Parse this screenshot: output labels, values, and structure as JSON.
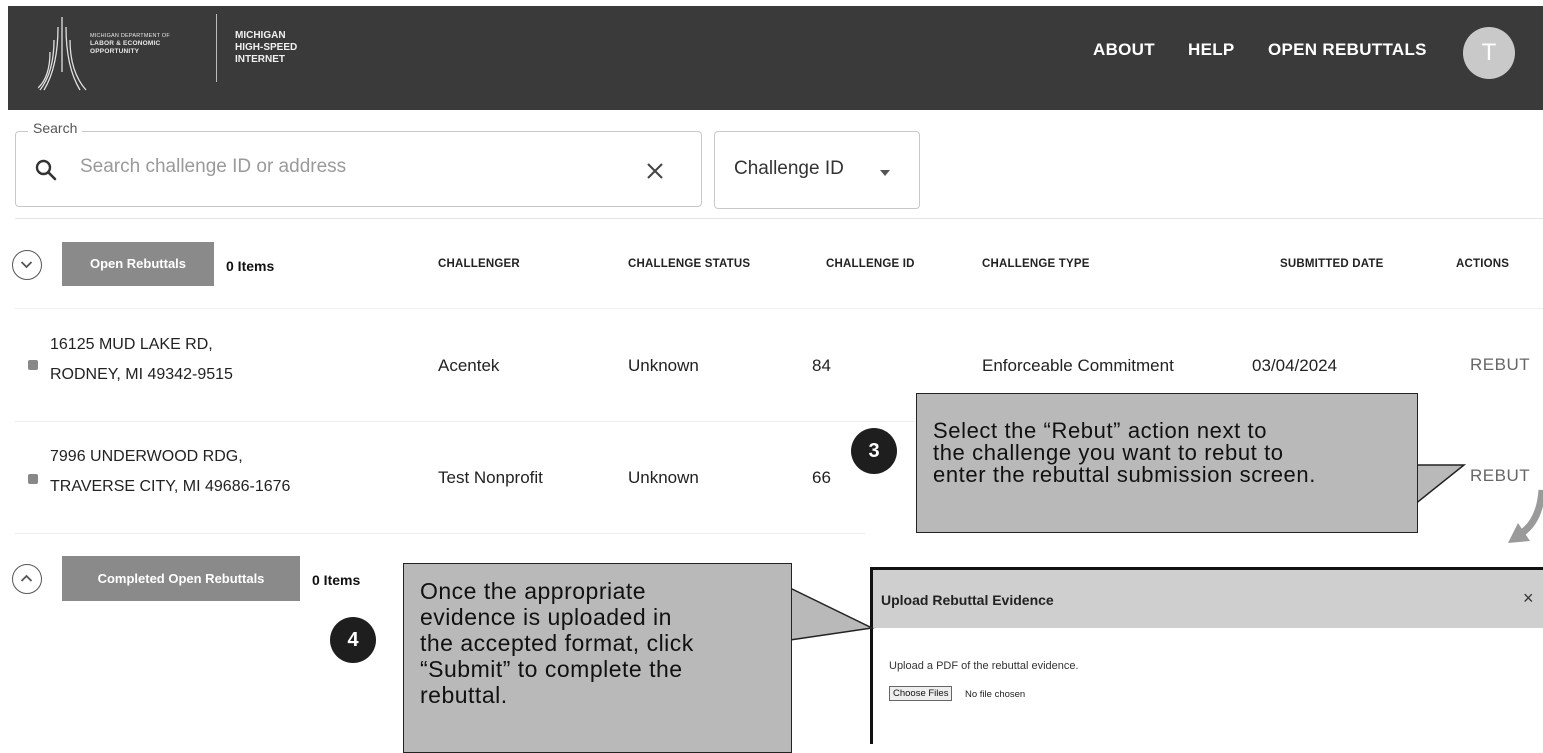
{
  "header": {
    "logo_lines": [
      "MICHIGAN DEPARTMENT OF",
      "LABOR & ECONOMIC",
      "OPPORTUNITY"
    ],
    "program_lines": [
      "MICHIGAN",
      "HIGH-SPEED",
      "INTERNET"
    ],
    "nav": [
      "ABOUT",
      "HELP",
      "OPEN REBUTTALS"
    ],
    "avatar_initial": "T"
  },
  "search": {
    "legend": "Search",
    "placeholder": "Search challenge ID or address",
    "filter_selected": "Challenge ID"
  },
  "columns": [
    "CHALLENGER",
    "CHALLENGE STATUS",
    "CHALLENGE ID",
    "CHALLENGE TYPE",
    "SUBMITTED DATE",
    "ACTIONS"
  ],
  "groups": {
    "open": {
      "label": "Open Rebuttals",
      "count": "0 Items"
    },
    "completed": {
      "label": "Completed Open Rebuttals",
      "count": "0 Items"
    }
  },
  "rows": [
    {
      "address_line1": "16125 MUD LAKE RD,",
      "address_line2": "RODNEY, MI 49342-9515",
      "challenger": "Acentek",
      "status": "Unknown",
      "challenge_id": "84",
      "type": "Enforceable Commitment",
      "date": "03/04/2024",
      "action": "REBUT"
    },
    {
      "address_line1": "7996 UNDERWOOD RDG,",
      "address_line2": "TRAVERSE CITY, MI 49686-1676",
      "challenger": "Test Nonprofit",
      "status": "Unknown",
      "challenge_id": "66",
      "action": "REBUT"
    }
  ],
  "callouts": {
    "step3": {
      "number": "3",
      "lines": [
        "Select the “Rebut” action next to",
        "the challenge you want to rebut to",
        "enter the rebuttal submission screen."
      ]
    },
    "step4": {
      "number": "4",
      "lines": [
        "Once the appropriate",
        "evidence is uploaded in",
        "the accepted format, click",
        "“Submit” to complete the",
        "rebuttal."
      ]
    }
  },
  "modal": {
    "title": "Upload Rebuttal Evidence",
    "close": "×",
    "instruction": "Upload a PDF of the rebuttal evidence.",
    "file_button": "Choose Files",
    "file_status": "No file chosen"
  }
}
